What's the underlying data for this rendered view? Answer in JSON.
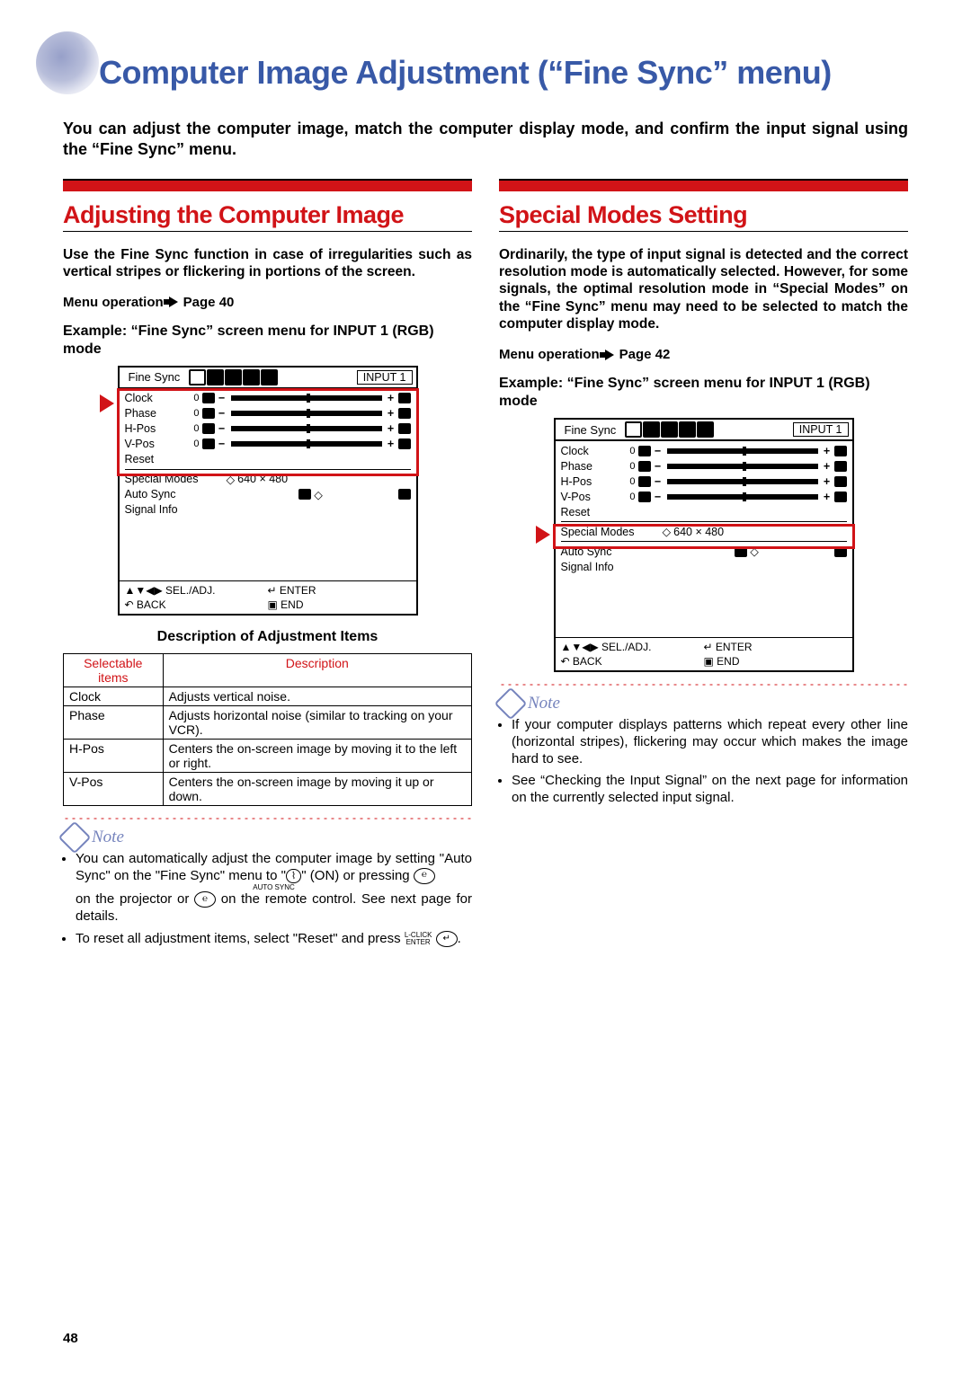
{
  "title": "Computer Image Adjustment (“Fine Sync” menu)",
  "intro": "You can adjust the computer image, match the computer display mode, and confirm the input signal using the “Fine Sync” menu.",
  "page_number": "48",
  "left": {
    "heading": "Adjusting the Computer Image",
    "body": "Use the Fine Sync function in case of irregularities such as vertical stripes or flickering in portions of the screen.",
    "menu_op_label": "Menu operation",
    "menu_op_page": "Page 40",
    "example_head": "Example: “Fine Sync” screen menu for INPUT 1 (RGB) mode",
    "desc_head": "Description of Adjustment Items",
    "table": {
      "h1": "Selectable items",
      "h2": "Description",
      "rows": [
        {
          "item": "Clock",
          "desc": "Adjusts vertical noise."
        },
        {
          "item": "Phase",
          "desc": "Adjusts horizontal noise (similar to tracking on your VCR)."
        },
        {
          "item": "H-Pos",
          "desc": "Centers the on-screen image by moving it to the left or right."
        },
        {
          "item": "V-Pos",
          "desc": "Centers the on-screen image by moving it up or down."
        }
      ]
    },
    "note_label": "Note",
    "notes": [
      "You can automatically adjust the computer image by setting “Auto Sync” on the “Fine Sync” menu to “ ” (ON) or pressing   on the projector or   on the remote control. See next page for details.",
      "To reset all adjustment items, select “Reset” and press  ."
    ]
  },
  "right": {
    "heading": "Special Modes Setting",
    "body": "Ordinarily, the type of input signal is detected and the correct resolution mode is automatically selected. However, for some signals, the optimal resolution mode in “Special Modes” on the “Fine Sync” menu may need to be selected to match the computer display mode.",
    "menu_op_label": "Menu operation",
    "menu_op_page": "Page 42",
    "example_head": "Example: “Fine Sync” screen menu for INPUT 1 (RGB) mode",
    "note_label": "Note",
    "notes": [
      "If your computer displays patterns which repeat every other line (horizontal stripes), flickering may occur which makes the image hard to see.",
      "See “Checking the Input Signal” on the next page for information on the currently selected input signal."
    ]
  },
  "osd": {
    "title": "Fine Sync",
    "input": "INPUT 1",
    "items": [
      "Clock",
      "Phase",
      "H-Pos",
      "V-Pos",
      "Reset"
    ],
    "value": "0",
    "below": [
      "Special Modes",
      "Auto Sync",
      "Signal Info"
    ],
    "special_val": "640 × 480",
    "foot": {
      "seladj": "SEL./ADJ.",
      "enter": "ENTER",
      "back": "BACK",
      "end": "END"
    }
  }
}
